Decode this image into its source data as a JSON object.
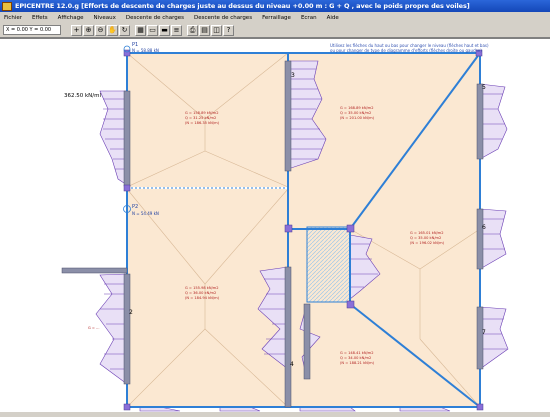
{
  "window": {
    "title": "EPICENTRE 12.0.g   [Efforts de descente de charges juste au dessus du niveau +0.00 m : G + Q , avec le poids propre des voiles]"
  },
  "menu": [
    "Fichier",
    "Effets",
    "Affichage",
    "Niveaux",
    "Descente de charges",
    "Descente de charges",
    "Ferraillage",
    "Ecran",
    "Aide"
  ],
  "toolbar": {
    "coord_value": "X = 0.00     Y = 0.00"
  },
  "drawing": {
    "hint_line1": "Utilisez les flèches du haut ou bas pour changer le niveau (flèches haut et bas)",
    "hint_line2": "ou pour changer de type de diagramme d'efforts (flèches droite ou gauche)",
    "dimension_label": "362.50 kN/ml",
    "points": [
      {
        "label": "P1",
        "value": "N = 58.88 kN"
      },
      {
        "label": "P2",
        "value": "N = 54.49 kN"
      }
    ],
    "wall_numbers": [
      "3",
      "5",
      "6",
      "2",
      "4",
      "7"
    ],
    "panel_labels": [
      [
        "G = 158.89 kN/m2",
        "Q = 31.25 kN/m2",
        "(N = 186.35 kN/m)"
      ],
      [
        "G = 168.89 kN/m2",
        "Q = 35.00 kN/m2",
        "(N = 201.00 kN/m)"
      ],
      [
        "G = 155.98 kN/m2",
        "Q = 36.00 kN/m2",
        "(N = 184.94 kN/m)"
      ],
      [
        "G = 165.01 kN/m2",
        "Q = 35.00 kN/m2",
        "(N = 196.02 kN/m)"
      ],
      [
        "G = 148.41 kN/m2",
        "Q = 34.00 kN/m2",
        "(N = 188.21 kN/m)"
      ]
    ]
  },
  "colors": {
    "floor_fill": "#fbe8d2",
    "wall": "#2e7fd6",
    "diagram": "#6b3fb5",
    "text_red": "#b02020",
    "hatch": "#cfe4f5"
  },
  "icons": [
    "pointer-icon",
    "zoom-in-icon",
    "zoom-out-icon",
    "hand-icon",
    "refresh-icon",
    "grid-icon",
    "wall-icon",
    "beam-icon",
    "layer-icon",
    "print-icon",
    "preview-icon",
    "export-icon",
    "info-icon"
  ]
}
